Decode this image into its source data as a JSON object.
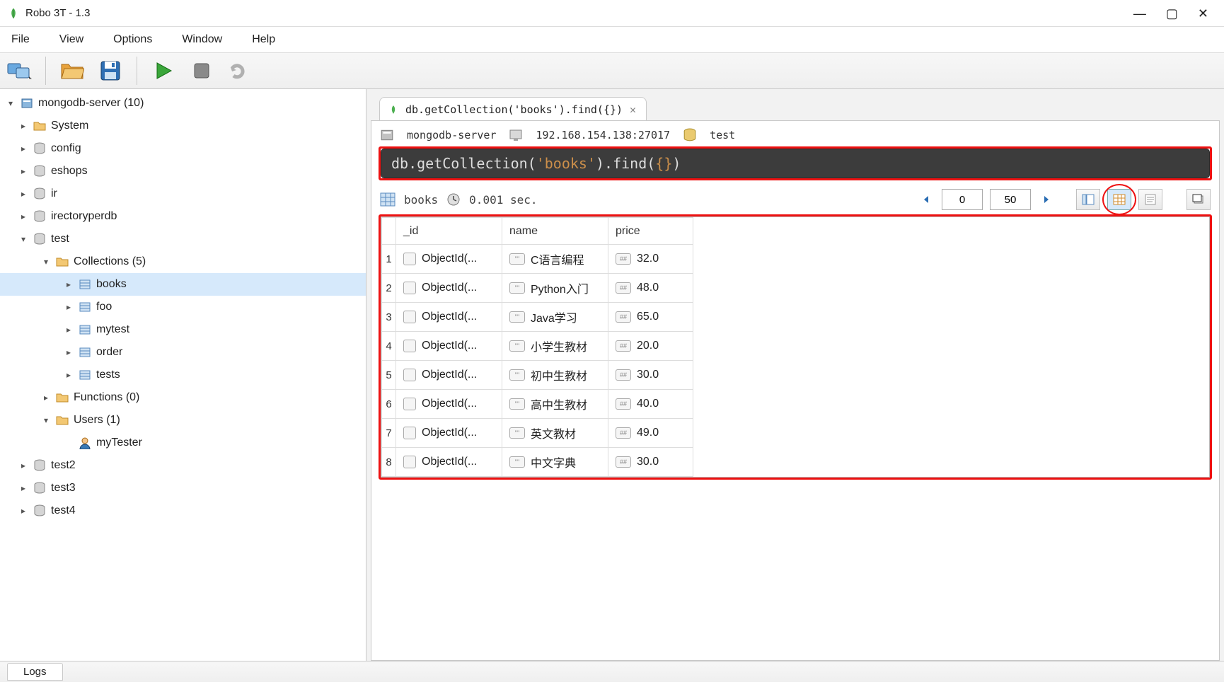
{
  "app": {
    "title": "Robo 3T - 1.3"
  },
  "menu": {
    "file": "File",
    "view": "View",
    "options": "Options",
    "window": "Window",
    "help": "Help"
  },
  "sidebar": {
    "server": "mongodb-server (10)",
    "dbs": {
      "system": "System",
      "config": "config",
      "eshops": "eshops",
      "ir": "ir",
      "irectoryperdb": "irectoryperdb",
      "test": "test",
      "test2": "test2",
      "test3": "test3",
      "test4": "test4"
    },
    "test": {
      "collections": "Collections (5)",
      "items": {
        "books": "books",
        "foo": "foo",
        "mytest": "mytest",
        "order": "order",
        "tests": "tests"
      },
      "functions": "Functions (0)",
      "users": "Users (1)",
      "user": "myTester"
    }
  },
  "tab": {
    "title": "db.getCollection('books').find({})",
    "ctx_server": "mongodb-server",
    "ctx_host": "192.168.154.138:27017",
    "ctx_db": "test"
  },
  "query": {
    "prefix": "db.getCollection(",
    "arg": "'books'",
    "mid": ").find(",
    "brace": "{}",
    "suffix": ")"
  },
  "result": {
    "coll": "books",
    "time": "0.001 sec.",
    "offset": "0",
    "limit": "50",
    "columns": {
      "id": "_id",
      "name": "name",
      "price": "price"
    },
    "rows": [
      {
        "n": "1",
        "id": "ObjectId(...",
        "name": "C语言编程",
        "price": "32.0"
      },
      {
        "n": "2",
        "id": "ObjectId(...",
        "name": "Python入门",
        "price": "48.0"
      },
      {
        "n": "3",
        "id": "ObjectId(...",
        "name": "Java学习",
        "price": "65.0"
      },
      {
        "n": "4",
        "id": "ObjectId(...",
        "name": "小学生教材",
        "price": "20.0"
      },
      {
        "n": "5",
        "id": "ObjectId(...",
        "name": "初中生教材",
        "price": "30.0"
      },
      {
        "n": "6",
        "id": "ObjectId(...",
        "name": "高中生教材",
        "price": "40.0"
      },
      {
        "n": "7",
        "id": "ObjectId(...",
        "name": "英文教材",
        "price": "49.0"
      },
      {
        "n": "8",
        "id": "ObjectId(...",
        "name": "中文字典",
        "price": "30.0"
      }
    ]
  },
  "status": {
    "logs": "Logs"
  }
}
